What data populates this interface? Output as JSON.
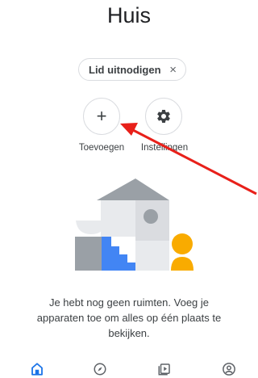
{
  "header": {
    "title": "Huis"
  },
  "invite_chip": {
    "label": "Lid uitnodigen",
    "close_icon": "close-icon",
    "close_glyph": "×"
  },
  "actions": {
    "add": {
      "label": "Toevoegen",
      "icon": "plus-icon",
      "glyph": "+"
    },
    "settings": {
      "label": "Instellingen",
      "icon": "gear-icon"
    }
  },
  "empty_state": {
    "illustration": "house-illustration",
    "message": "Je hebt nog geen ruimten. Voeg je apparaten toe om alles op één plaats te bekijken."
  },
  "bottom_nav": [
    {
      "name": "home",
      "icon": "home-icon",
      "active": true
    },
    {
      "name": "discover",
      "icon": "compass-icon",
      "active": false
    },
    {
      "name": "media",
      "icon": "media-icon",
      "active": false
    },
    {
      "name": "account",
      "icon": "account-icon",
      "active": false
    }
  ],
  "colors": {
    "accent": "#1a73e8",
    "annotation_arrow": "#e8201a",
    "illustration_yellow": "#f9ab00",
    "illustration_blue": "#4285f4"
  }
}
